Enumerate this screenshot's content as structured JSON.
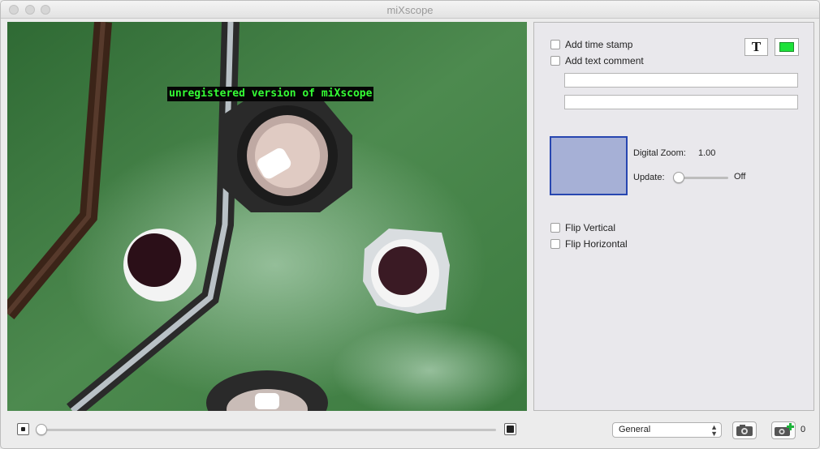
{
  "window": {
    "title": "miXscope"
  },
  "video": {
    "watermark": "unregistered version of miXscope"
  },
  "panel": {
    "add_time_stamp": "Add time stamp",
    "add_text_comment": "Add text comment",
    "text_button": "T",
    "comment_line_1": "",
    "comment_line_2": "",
    "digital_zoom_label": "Digital Zoom:",
    "digital_zoom_value": "1.00",
    "update_label": "Update:",
    "update_state": "Off",
    "flip_vertical": "Flip Vertical",
    "flip_horizontal": "Flip Horizontal"
  },
  "bottom": {
    "preset_select": "General",
    "photo_count": "0"
  },
  "colors": {
    "watermark_text": "#35ff35",
    "text_color_swatch": "#1de23a",
    "zoom_preview": "#a6b0d6"
  }
}
